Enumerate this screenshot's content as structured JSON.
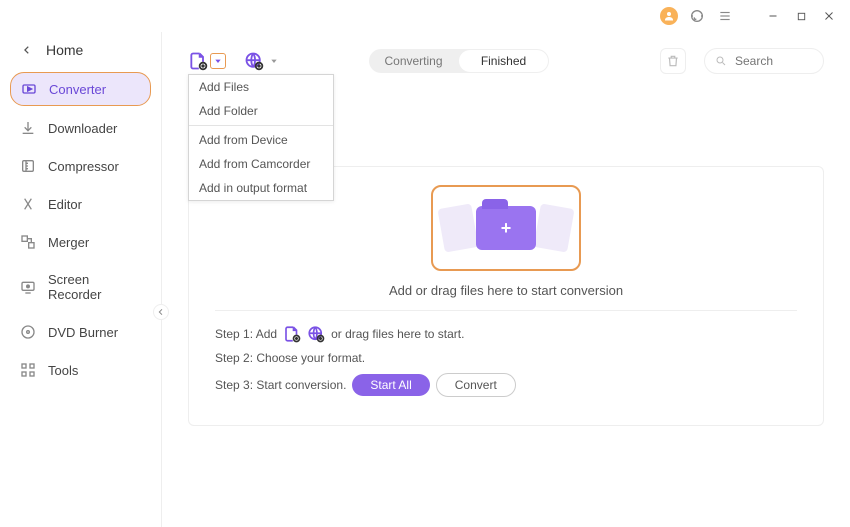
{
  "titlebar": {},
  "home_label": "Home",
  "sidebar": {
    "items": [
      {
        "label": "Converter"
      },
      {
        "label": "Downloader"
      },
      {
        "label": "Compressor"
      },
      {
        "label": "Editor"
      },
      {
        "label": "Merger"
      },
      {
        "label": "Screen Recorder"
      },
      {
        "label": "DVD Burner"
      },
      {
        "label": "Tools"
      }
    ]
  },
  "tabs": {
    "converting": "Converting",
    "finished": "Finished"
  },
  "search": {
    "placeholder": "Search"
  },
  "dropdown": {
    "items": [
      "Add Files",
      "Add Folder",
      "Add from Device",
      "Add from Camcorder",
      "Add in output format"
    ]
  },
  "dropzone": {
    "text": "Add or drag files here to start conversion"
  },
  "steps": {
    "s1a": "Step 1: Add",
    "s1b": "or drag files here to start.",
    "s2": "Step 2: Choose your format.",
    "s3": "Step 3: Start conversion.",
    "start_all": "Start All",
    "convert": "Convert"
  }
}
